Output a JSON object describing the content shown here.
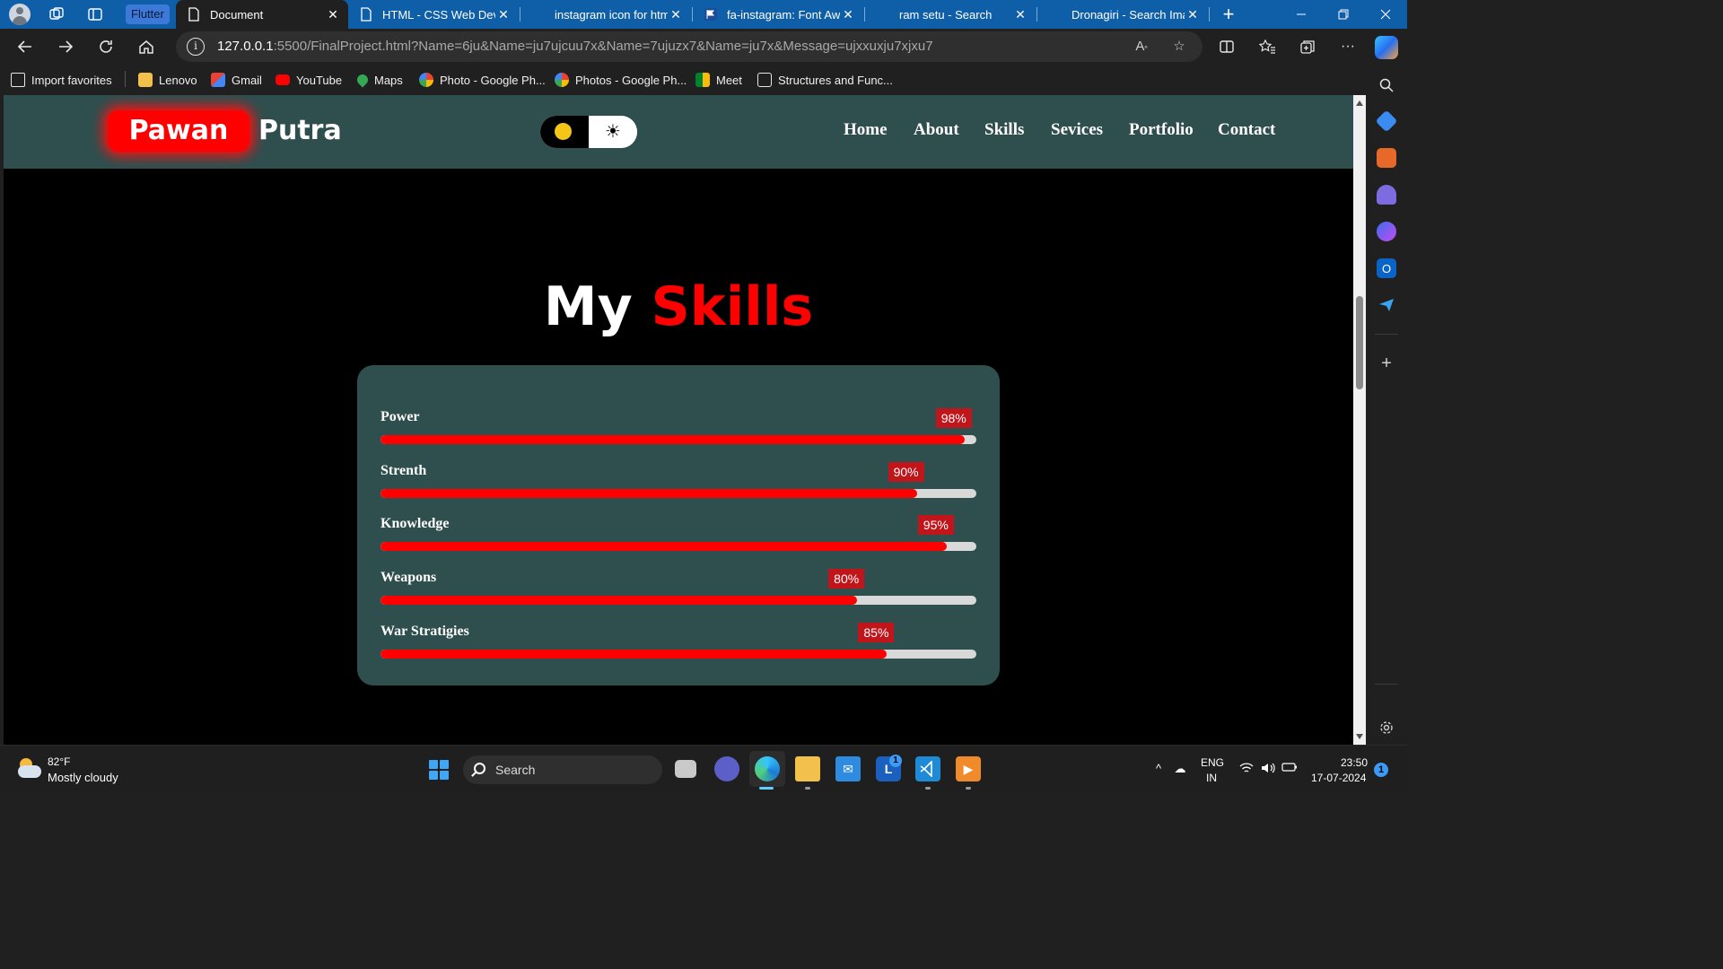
{
  "browser": {
    "flutter_chip": "Flutter",
    "tabs": [
      {
        "title": "Document",
        "favicon": "document-icon",
        "active": true
      },
      {
        "title": "HTML - CSS Web Devel",
        "favicon": "document-icon"
      },
      {
        "title": "instagram icon for htm",
        "favicon": "bing-icon"
      },
      {
        "title": "fa-instagram: Font Awe",
        "favicon": "flag-icon"
      },
      {
        "title": "ram setu - Search",
        "favicon": "bing-icon"
      },
      {
        "title": "Dronagiri - Search Imag",
        "favicon": "bing-icon"
      }
    ],
    "close_glyph": "✕",
    "new_tab_glyph": "+",
    "address": {
      "host": "127.0.0.1",
      "path": ":5500/FinalProject.html?Name=6ju&Name=ju7ujcuu7x&Name=7ujuzx7&Name=ju7x&Message=ujxxuxju7xjxu7"
    },
    "bookmarks": [
      {
        "label": "Import favorites",
        "icon": "import-icon"
      },
      {
        "label": "Lenovo",
        "icon": "folder-icon"
      },
      {
        "label": "Gmail",
        "icon": "gmail-icon"
      },
      {
        "label": "YouTube",
        "icon": "youtube-icon"
      },
      {
        "label": "Maps",
        "icon": "maps-icon"
      },
      {
        "label": "Photo - Google Ph...",
        "icon": "google-photos-icon"
      },
      {
        "label": "Photos - Google Ph...",
        "icon": "google-photos-icon"
      },
      {
        "label": "Meet",
        "icon": "meet-icon"
      },
      {
        "label": "Structures and Func...",
        "icon": "page-icon"
      }
    ]
  },
  "site": {
    "logo_first": "Pawan",
    "logo_second": "Putra",
    "theme_toggle": {
      "light_glyph": "☀",
      "dark_icon": "moon-icon"
    },
    "nav": [
      "Home",
      "About",
      "Skills",
      "Sevices",
      "Portfolio",
      "Contact"
    ],
    "skills_title_first": "My",
    "skills_title_accent": "Skills",
    "skills": [
      {
        "name": "Power",
        "percent": 98,
        "label": "98%"
      },
      {
        "name": "Strenth",
        "percent": 90,
        "label": "90%"
      },
      {
        "name": "Knowledge",
        "percent": 95,
        "label": "95%"
      },
      {
        "name": "Weapons",
        "percent": 80,
        "label": "80%"
      },
      {
        "name": "War Stratigies",
        "percent": 85,
        "label": "85%"
      }
    ],
    "colors": {
      "accent": "#ff0000",
      "header_bg": "#2f4f4f",
      "badge": "#c0151b",
      "track": "#d9d9d9"
    }
  },
  "taskbar": {
    "weather_temp": "82°F",
    "weather_desc": "Mostly cloudy",
    "search_label": "Search",
    "language_top": "ENG",
    "language_bottom": "IN",
    "time": "23:50",
    "date": "17-07-2024",
    "notification_count": "1",
    "app_badge": "1"
  }
}
